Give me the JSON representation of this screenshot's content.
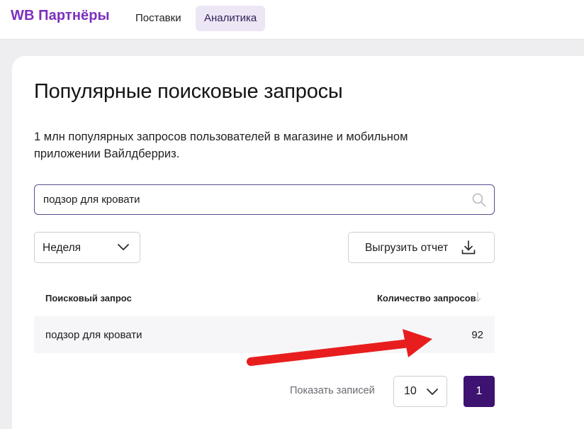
{
  "topbar": {
    "brand": "WB Партнёры",
    "tabs": [
      {
        "label": "Поставки",
        "active": false
      },
      {
        "label": "Аналитика",
        "active": true
      }
    ]
  },
  "page": {
    "title": "Популярные поисковые запросы",
    "description": "1 млн популярных запросов пользователей в магазине и мобильном приложении Вайлдберриз."
  },
  "search": {
    "value": "подзор для кровати",
    "icon": "search-icon"
  },
  "filters": {
    "period_selected": "Неделя",
    "export_label": "Выгрузить отчет"
  },
  "table": {
    "columns": [
      "Поисковый запрос",
      "Количество запросов"
    ],
    "rows": [
      {
        "query": "подзор для кровати",
        "count": "92"
      }
    ]
  },
  "pagination": {
    "show_label": "Показать записей",
    "page_size": "10",
    "current_page": "1"
  },
  "colors": {
    "brand": "#7b2fbf",
    "active_tab_bg": "#ece6f5",
    "page_button": "#3d1270",
    "annotation_arrow": "#e81e1e"
  }
}
